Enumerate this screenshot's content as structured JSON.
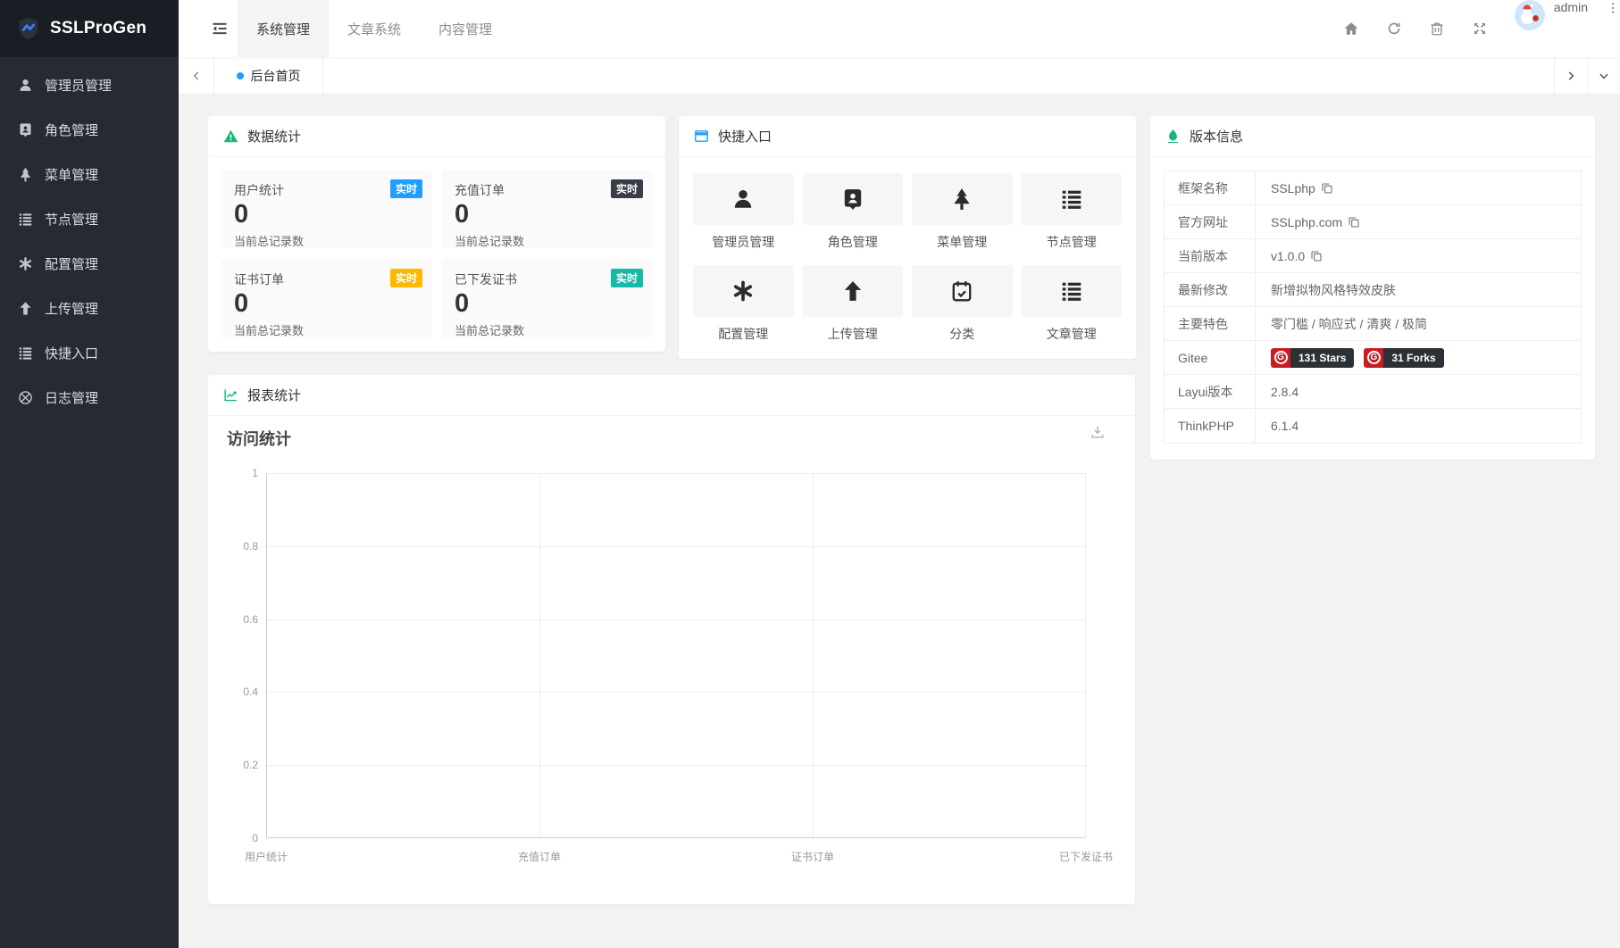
{
  "app": {
    "logo_text": "SSLProGen"
  },
  "colors": {
    "accent_blue": "#1E9FFF",
    "badge_dark": "#393D49",
    "badge_orange": "#FFB800",
    "badge_teal": "#16BAAA",
    "teal_icon": "#16b777",
    "gitee_red": "#C71D23",
    "sidebar_bg": "#252a33"
  },
  "sidebar": {
    "items": [
      {
        "label": "管理员管理",
        "icon": "user-icon"
      },
      {
        "label": "角色管理",
        "icon": "role-badge-icon"
      },
      {
        "label": "菜单管理",
        "icon": "tree-icon"
      },
      {
        "label": "节点管理",
        "icon": "list-icon"
      },
      {
        "label": "配置管理",
        "icon": "asterisk-icon"
      },
      {
        "label": "上传管理",
        "icon": "upload-arrow-icon"
      },
      {
        "label": "快捷入口",
        "icon": "list-icon"
      },
      {
        "label": "日志管理",
        "icon": "log-circle-icon"
      }
    ]
  },
  "header": {
    "tabs": [
      {
        "label": "系统管理",
        "active": true
      },
      {
        "label": "文章系统",
        "active": false
      },
      {
        "label": "内容管理",
        "active": false
      }
    ],
    "username": "admin",
    "icons": [
      "home-icon",
      "refresh-icon",
      "trash-icon",
      "fullscreen-icon",
      "more-vertical-icon"
    ]
  },
  "tabbar": {
    "active_tab": "后台首页"
  },
  "cards": {
    "stats": {
      "title": "数据统计",
      "items": [
        {
          "label": "用户统计",
          "badge": "实时",
          "badge_color": "#1E9FFF",
          "value": "0",
          "sub": "当前总记录数"
        },
        {
          "label": "充值订单",
          "badge": "实时",
          "badge_color": "#393D49",
          "value": "0",
          "sub": "当前总记录数"
        },
        {
          "label": "证书订单",
          "badge": "实时",
          "badge_color": "#FFB800",
          "value": "0",
          "sub": "当前总记录数"
        },
        {
          "label": "已下发证书",
          "badge": "实时",
          "badge_color": "#16BAAA",
          "value": "0",
          "sub": "当前总记录数"
        }
      ]
    },
    "shortcuts": {
      "title": "快捷入口",
      "items": [
        {
          "label": "管理员管理",
          "icon": "user-icon"
        },
        {
          "label": "角色管理",
          "icon": "role-badge-icon"
        },
        {
          "label": "菜单管理",
          "icon": "tree-icon"
        },
        {
          "label": "节点管理",
          "icon": "list-icon"
        },
        {
          "label": "配置管理",
          "icon": "asterisk-icon"
        },
        {
          "label": "上传管理",
          "icon": "upload-arrow-icon"
        },
        {
          "label": "分类",
          "icon": "calendar-check-icon"
        },
        {
          "label": "文章管理",
          "icon": "list-icon"
        }
      ]
    },
    "version": {
      "title": "版本信息",
      "rows": [
        {
          "label": "框架名称",
          "value": "SSLphp",
          "copy": true
        },
        {
          "label": "官方网址",
          "value": "SSLphp.com",
          "copy": true
        },
        {
          "label": "当前版本",
          "value": "v1.0.0",
          "copy": true
        },
        {
          "label": "最新修改",
          "value": "新增拟物风格特效皮肤"
        },
        {
          "label": "主要特色",
          "value": "零门槛 / 响应式 / 清爽 / 极简"
        },
        {
          "label": "Gitee",
          "badges": [
            "131 Stars",
            "31 Forks"
          ]
        },
        {
          "label": "Layui版本",
          "value": "2.8.4"
        },
        {
          "label": "ThinkPHP",
          "value": "6.1.4"
        }
      ]
    },
    "report": {
      "title": "报表统计"
    }
  },
  "chart_data": {
    "type": "line",
    "title": "访问统计",
    "categories": [
      "用户统计",
      "充值订单",
      "证书订单",
      "已下发证书"
    ],
    "values": [
      0,
      0,
      0,
      0
    ],
    "y_ticks": [
      0,
      0.2,
      0.4,
      0.6,
      0.8,
      1
    ],
    "ylim": [
      0,
      1
    ],
    "grid": true,
    "legend": false,
    "toolbox": "save-as-image"
  }
}
